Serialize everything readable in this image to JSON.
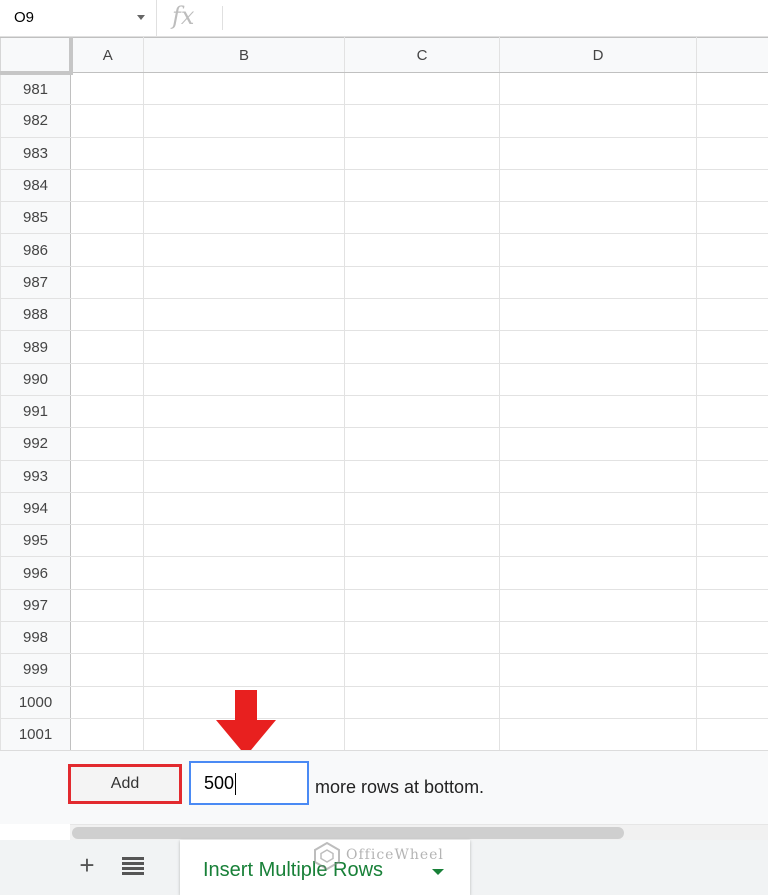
{
  "formula_bar": {
    "cell_reference": "O9",
    "fx_symbol": "fx"
  },
  "grid": {
    "columns": [
      "A",
      "B",
      "C",
      "D",
      ""
    ],
    "rows": [
      "981",
      "982",
      "983",
      "984",
      "985",
      "986",
      "987",
      "988",
      "989",
      "990",
      "991",
      "992",
      "993",
      "994",
      "995",
      "996",
      "997",
      "998",
      "999",
      "1000",
      "1001"
    ]
  },
  "add_rows": {
    "button_label": "Add",
    "input_value": "500",
    "suffix_text": "more rows at bottom."
  },
  "sheet_tabs": {
    "add_symbol": "+",
    "active_tab": "Insert Multiple Rows"
  },
  "watermark": {
    "text": "OfficeWheel"
  },
  "colors": {
    "highlight": "#e22a2f",
    "input_focus": "#4a8af4",
    "tab_text": "#188038",
    "arrow": "#e8201f"
  },
  "icons": [
    "dropdown-caret-icon",
    "fx-icon",
    "down-arrow-icon",
    "add-sheet-icon",
    "all-sheets-icon",
    "tab-caret-icon",
    "watermark-logo-icon"
  ]
}
